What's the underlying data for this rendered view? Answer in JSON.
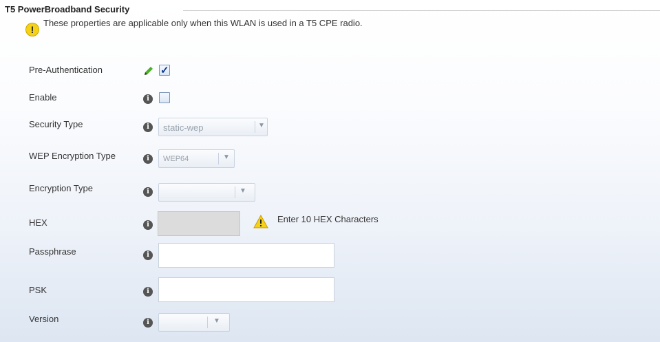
{
  "section": {
    "title": "T5 PowerBroadband Security",
    "note": "These properties are applicable only when this WLAN is used in a T5 CPE radio."
  },
  "fields": {
    "pre_authentication": {
      "label": "Pre-Authentication",
      "checked": true,
      "icon": "pencil-icon"
    },
    "enable": {
      "label": "Enable",
      "checked": false,
      "icon": "info-icon"
    },
    "security_type": {
      "label": "Security Type",
      "value": "static-wep"
    },
    "wep_encryption_type": {
      "label": "WEP Encryption Type",
      "value": "WEP64"
    },
    "encryption_type": {
      "label": "Encryption Type",
      "value": ""
    },
    "hex": {
      "label": "HEX",
      "warning": "Enter 10 HEX Characters"
    },
    "passphrase": {
      "label": "Passphrase",
      "value": ""
    },
    "psk": {
      "label": "PSK",
      "value": ""
    },
    "version": {
      "label": "Version",
      "value": ""
    }
  },
  "glyphs": {
    "info": "i",
    "note": "!",
    "arrow": "▼",
    "check": "✓"
  },
  "colors": {
    "info_icon": "#555555",
    "warning_yellow": "#f5d218",
    "checkbox_border": "#7a94b8",
    "check": "#0b3a8a"
  }
}
